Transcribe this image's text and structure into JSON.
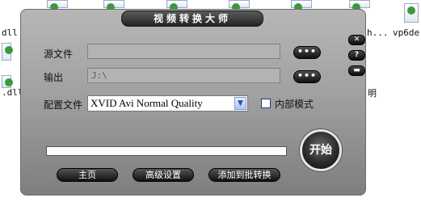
{
  "desktop": {
    "items": [
      {
        "label": "dll"
      },
      {
        "label": "h..."
      },
      {
        "label": "vp6de"
      },
      {
        "label": ".dll"
      },
      {
        "label": "明"
      }
    ]
  },
  "window": {
    "title": "视频转换大师",
    "source": {
      "label": "源文件",
      "value": "",
      "browse_label": "•••"
    },
    "output": {
      "label": "输出",
      "value": "J:\\",
      "browse_label": "•••"
    },
    "config": {
      "label": "配置文件",
      "selected": "XVID Avi Normal Quality",
      "dropdown_icon": "chevron-down-icon"
    },
    "internal_mode": {
      "label": "内部模式",
      "checked": false
    },
    "progress": {
      "percent": 0,
      "fill_color": "#3a6ad6"
    },
    "start_label": "开始",
    "buttons": {
      "home": "主页",
      "advanced": "高级设置",
      "batch": "添加到批转换"
    },
    "side": {
      "close_icon": "✕",
      "help_icon": "?",
      "minimize_icon": "▬"
    }
  }
}
